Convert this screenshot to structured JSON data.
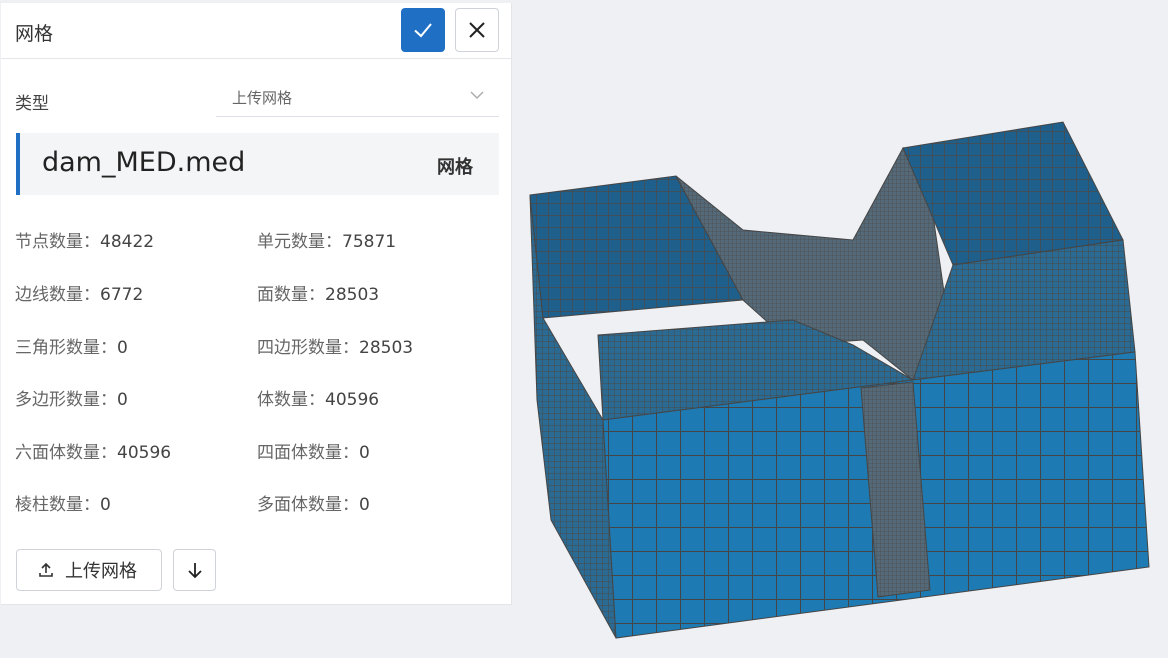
{
  "panel": {
    "title": "网格",
    "type_label": "类型",
    "type_value": "上传网格",
    "file_name": "dam_MED.med",
    "file_tag": "网格"
  },
  "stats": [
    {
      "label": "节点数量",
      "value": "48422"
    },
    {
      "label": "单元数量",
      "value": "75871"
    },
    {
      "label": "边线数量",
      "value": "6772"
    },
    {
      "label": "面数量",
      "value": "28503"
    },
    {
      "label": "三角形数量",
      "value": "0"
    },
    {
      "label": "四边形数量",
      "value": "28503"
    },
    {
      "label": "多边形数量",
      "value": "0"
    },
    {
      "label": "体数量",
      "value": "40596"
    },
    {
      "label": "六面体数量",
      "value": "40596"
    },
    {
      "label": "四面体数量",
      "value": "0"
    },
    {
      "label": "棱柱数量",
      "value": "0"
    },
    {
      "label": "多面体数量",
      "value": "0"
    }
  ],
  "buttons": {
    "upload_label": "上传网格"
  },
  "icons": {
    "confirm": "check-icon",
    "close": "close-icon",
    "select": "chevron-down-icon",
    "upload": "upload-icon",
    "download": "arrow-down-icon"
  },
  "colors": {
    "accent": "#1f6fc5",
    "mesh_face": "#1f77b4",
    "mesh_edge": "#4a4a4a"
  }
}
